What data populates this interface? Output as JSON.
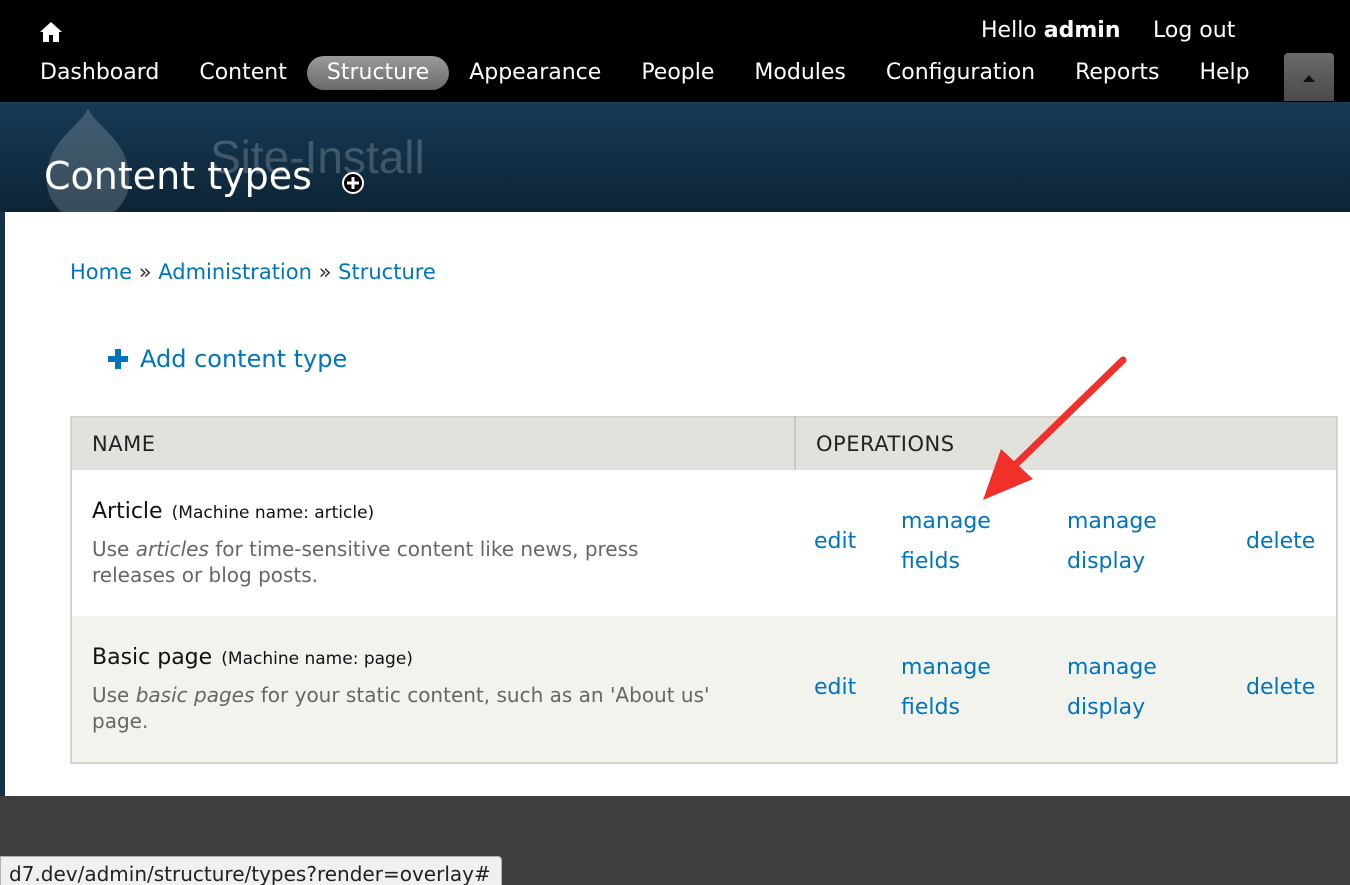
{
  "toolbar": {
    "hello_prefix": "Hello ",
    "user": "admin",
    "logout": "Log out",
    "menu": [
      {
        "label": "Dashboard"
      },
      {
        "label": "Content"
      },
      {
        "label": "Structure",
        "active": true
      },
      {
        "label": "Appearance"
      },
      {
        "label": "People"
      },
      {
        "label": "Modules"
      },
      {
        "label": "Configuration"
      },
      {
        "label": "Reports"
      },
      {
        "label": "Help"
      }
    ]
  },
  "header": {
    "site_name": "Site-Install",
    "page_title": "Content types"
  },
  "breadcrumb": {
    "items": [
      "Home",
      "Administration",
      "Structure"
    ],
    "separator": "»"
  },
  "actions": {
    "add_content_type": "Add content type"
  },
  "table": {
    "headers": {
      "name": "NAME",
      "operations": "OPERATIONS"
    },
    "rows": [
      {
        "title": "Article",
        "machine": "(Machine name: article)",
        "desc_before": "Use ",
        "desc_em": "articles",
        "desc_after": " for time-sensitive content like news, press releases or blog posts.",
        "ops": {
          "edit": "edit",
          "manage_fields": "manage fields",
          "manage_display": "manage display",
          "delete": "delete"
        }
      },
      {
        "title": "Basic page",
        "machine": "(Machine name: page)",
        "desc_before": "Use ",
        "desc_em": "basic pages",
        "desc_after": " for your static content, such as an 'About us' page.",
        "ops": {
          "edit": "edit",
          "manage_fields": "manage fields",
          "manage_display": "manage display",
          "delete": "delete"
        }
      }
    ]
  },
  "statusbar": {
    "url": "d7.dev/admin/structure/types?render=overlay#"
  },
  "colors": {
    "link": "#0074bd",
    "toolbar_bg": "#000000",
    "header_bg": "#183a55",
    "annotation_arrow": "#f0302a"
  },
  "icons": {
    "home": "home-icon",
    "add_shortcut": "plus-circle-icon",
    "add": "plus-icon",
    "shortcut_toggle": "triangle-up-icon",
    "logo": "drupal-logo"
  }
}
